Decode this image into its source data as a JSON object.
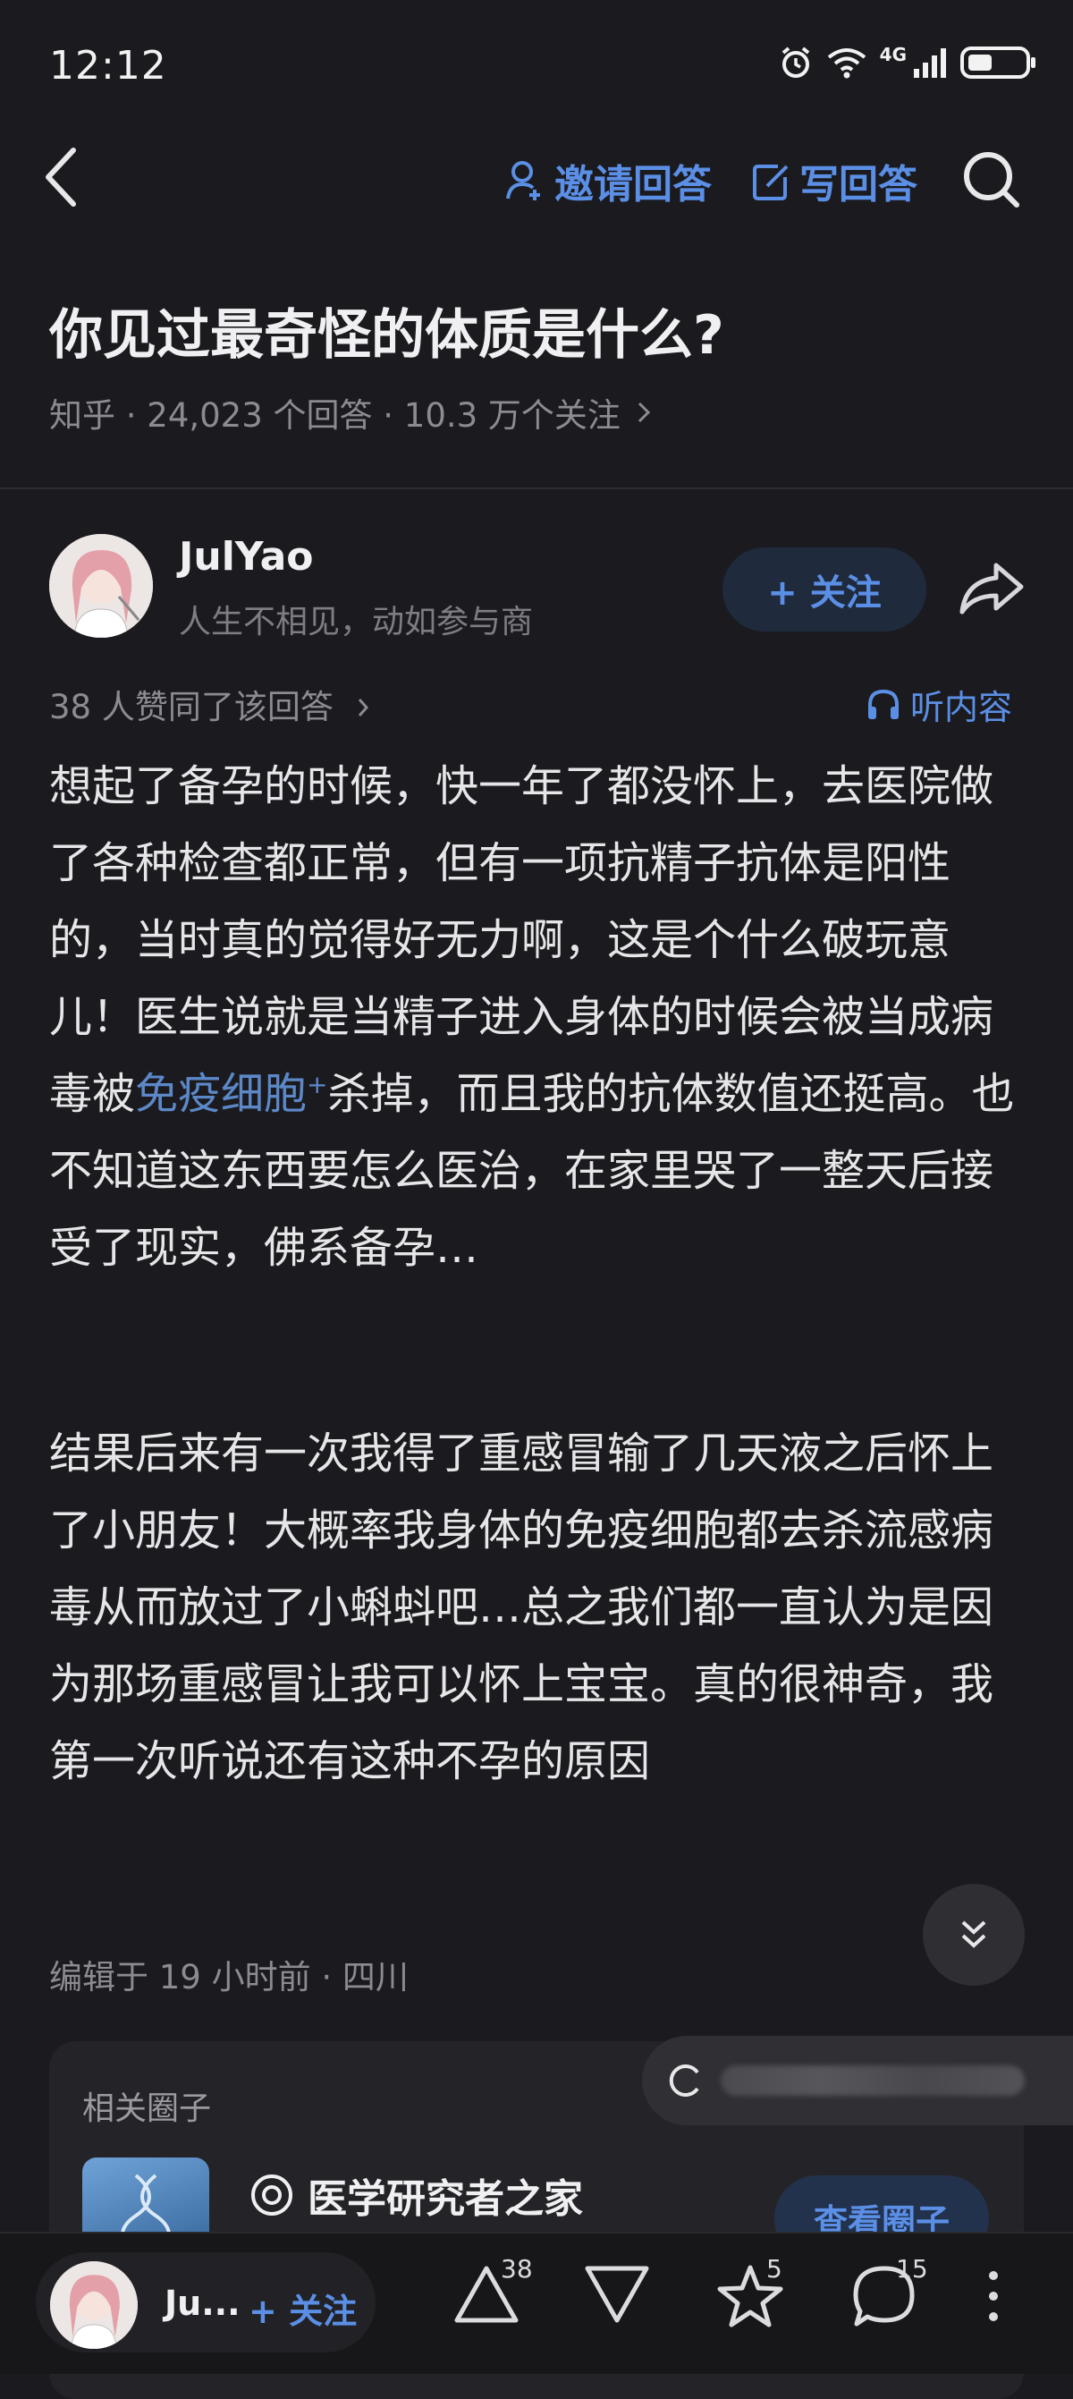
{
  "status_bar": {
    "time": "12:12",
    "network": "4G",
    "icons": [
      "alarm-icon",
      "wifi-icon",
      "signal-icon",
      "battery-icon"
    ]
  },
  "nav": {
    "invite_label": "邀请回答",
    "write_label": "写回答",
    "icons": [
      "back-icon",
      "person-icon",
      "edit-icon",
      "search-icon"
    ]
  },
  "question": {
    "title": "你见过最奇怪的体质是什么?",
    "meta": "知乎 · 24,023 个回答 · 10.3 万个关注"
  },
  "author": {
    "name": "JulYao",
    "bio": "人生不相见，动如参与商",
    "follow_label": "+ 关注"
  },
  "answer": {
    "vote_summary": "38 人赞同了该回答",
    "listen_label": "听内容",
    "p1_before_link": "想起了备孕的时候，快一年了都没怀上，去医院做了各种检查都正常，但有一项抗精子抗体是阳性的，当时真的觉得好无力啊，这是个什么破玩意儿！医生说就是当精子进入身体的时候会被当成病毒被",
    "p1_link": "免疫细胞",
    "p1_link_mark": "+",
    "p1_after_link": "杀掉，而且我的抗体数值还挺高。也不知道这东西要怎么医治，在家里哭了一整天后接受了现实，佛系备孕…",
    "p2": "结果后来有一次我得了重感冒输了几天液之后怀上了小朋友！大概率我身体的免疫细胞都去杀流感病毒从而放过了小蝌蚪吧…总之我们都一直认为是因为那场重感冒让我可以怀上宝宝。真的很神奇，我第一次听说还有这种不孕的原因",
    "edited": "编辑于 19 小时前 · 四川"
  },
  "related": {
    "label": "相关圈子",
    "circle_name": "医学研究者之家",
    "view_label": "查看圈子"
  },
  "bottom_bar": {
    "author_short": "Ju...",
    "follow_label": "+ 关注",
    "upvotes": "38",
    "favorites": "5",
    "comments": "15",
    "icons": [
      "upvote-icon",
      "downvote-icon",
      "star-icon",
      "comment-icon",
      "more-icon"
    ]
  },
  "colors": {
    "background": "#1b1b1f",
    "accent": "#5b8fe6",
    "link": "#5c88c8",
    "muted": "#8b8b90"
  }
}
